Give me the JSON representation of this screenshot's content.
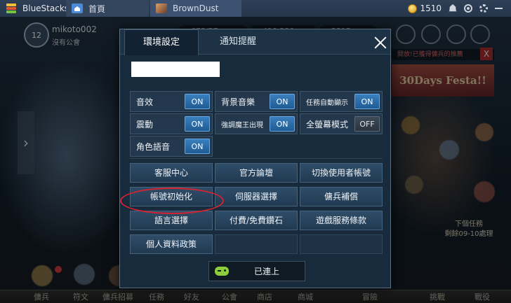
{
  "titlebar": {
    "app_name": "BlueStacks",
    "tabs": [
      {
        "label": "首頁",
        "icon": "home-icon"
      },
      {
        "label": "BrownDust",
        "icon": "game-icon"
      }
    ],
    "coins": "1510"
  },
  "hud": {
    "level": "12",
    "player_name": "mikoto002",
    "guild": "沒有公會",
    "resources": [
      "673/57",
      "410 220",
      "2315"
    ]
  },
  "background": {
    "banner_text": "30Days Festa!!",
    "banner_top": "開放!已獲得傭兵的推薦",
    "banner_close": "X",
    "side_arrow": "›",
    "next_task_line1": "下個任務",
    "next_task_line2": "剩餘09-10處理",
    "bottom_nav": [
      "傭兵",
      "符文",
      "傭兵招募",
      "任務",
      "好友",
      "公會",
      "商店",
      "商城",
      "冒險",
      "挑戰",
      "戰役"
    ]
  },
  "dialog": {
    "tabs": [
      {
        "label": "環境設定",
        "active": true
      },
      {
        "label": "通知提醒",
        "active": false
      }
    ],
    "toggles": [
      {
        "label": "音效",
        "state": "ON"
      },
      {
        "label": "背景音樂",
        "state": "ON"
      },
      {
        "label": "任務自動顯示",
        "state": "ON"
      },
      {
        "label": "震動",
        "state": "ON"
      },
      {
        "label": "強調魔王出現",
        "state": "ON"
      },
      {
        "label": "全螢幕模式",
        "state": "OFF"
      },
      {
        "label": "角色語音",
        "state": "ON"
      }
    ],
    "buttons": [
      "客服中心",
      "官方論壇",
      "切換使用者帳號",
      "帳號初始化",
      "伺服器選擇",
      "傭兵補償",
      "語言選擇",
      "付費/免費鑽石",
      "遊戲服務條款",
      "個人資料政策"
    ],
    "connect_label": "已連上"
  },
  "colors": {
    "toggle_on": "#2a6ea8",
    "toggle_off": "#34404c",
    "highlight": "#d8222f",
    "panel": "#182b3c"
  }
}
